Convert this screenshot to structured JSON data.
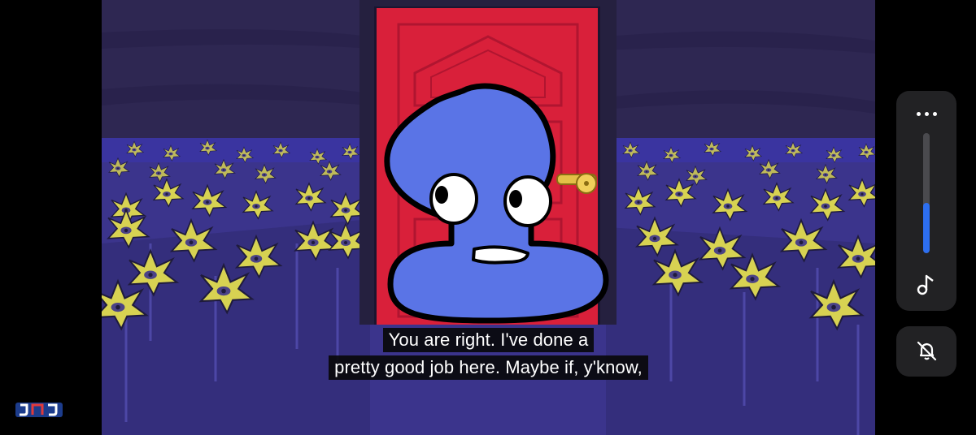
{
  "video": {
    "subtitles": [
      "You are right. I've done a",
      "pretty good job here. Maybe if, y'know,"
    ]
  },
  "overlay": {
    "more_button_icon": "more-horizontal-icon",
    "volume_level": 0.42,
    "media_volume_icon": "music-note-icon",
    "mute_button_icon": "bell-off-icon",
    "accent_color": "#2d6ff0"
  },
  "branding": {
    "logo_icon": "channel-logo-icon"
  }
}
